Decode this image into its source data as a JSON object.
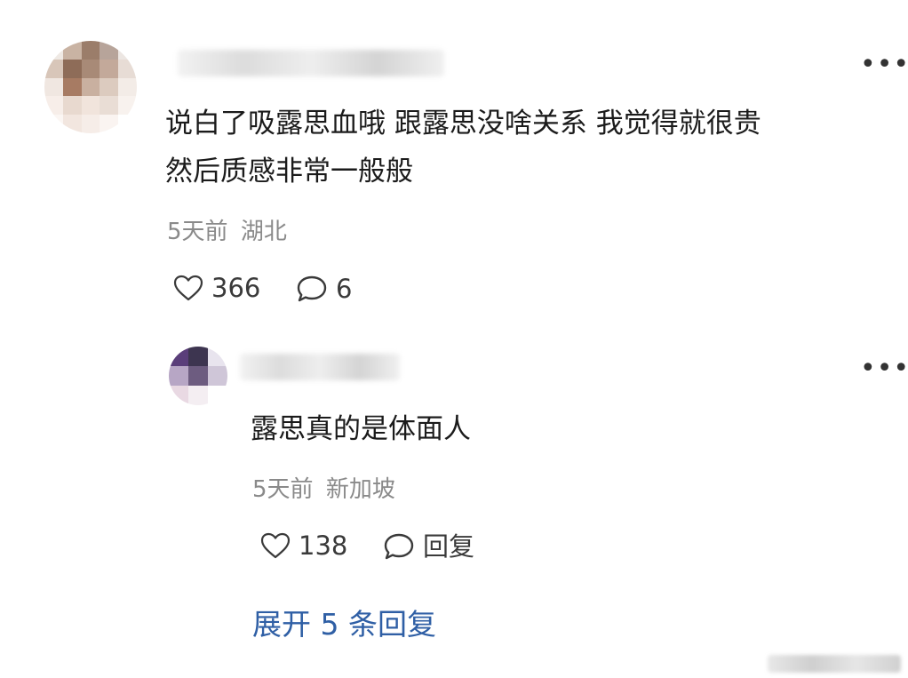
{
  "comment": {
    "text_line1": "说白了吸露思血哦 跟露思没啥关系 我觉得就很贵",
    "text_line2": "然后质感非常一般般",
    "time": "5天前",
    "location": "湖北",
    "like_count": "366",
    "reply_count": "6",
    "avatar_colors": [
      "#efe9e4",
      "#c9b3a3",
      "#9b7d6a",
      "#b7a49a",
      "#ece6e2",
      "#d8c6b9",
      "#8e6c58",
      "#a88a77",
      "#c3a99a",
      "#e7dcd5",
      "#f0e7e1",
      "#a77b63",
      "#c9b0a0",
      "#dccbbf",
      "#f3ece7",
      "#f7eee9",
      "#e8d9cf",
      "#f1e4dc",
      "#e9ddd5",
      "#f8f2ee",
      "#fbf6f3",
      "#f2e6df",
      "#f6ede8",
      "#faf4f1",
      "#ffffff"
    ]
  },
  "reply": {
    "text": "露思真的是体面人",
    "time": "5天前",
    "location": "新加坡",
    "like_count": "138",
    "reply_label": "回复",
    "avatar_colors": [
      "#5a3e7a",
      "#3d3550",
      "#e8e4ee",
      "#b7a6c5",
      "#6d5c80",
      "#cfc6d8",
      "#e9d9e3",
      "#f4eef2",
      "#ffffff"
    ]
  },
  "expand_replies": {
    "label": "展开 5 条回复"
  },
  "icons": {
    "more": "more-horizontal-icon",
    "like": "heart-outline-icon",
    "comment": "comment-bubble-icon"
  },
  "colors": {
    "link": "#2f5fa5",
    "meta": "#8a8a8a"
  }
}
